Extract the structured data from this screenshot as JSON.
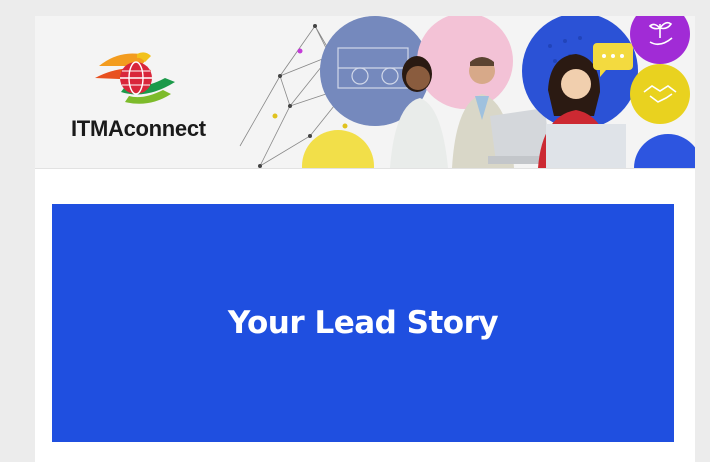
{
  "header": {
    "logo_text": "ITMAconnect",
    "logo_icon": "itma-globe-logo",
    "banner_icons": [
      "plant-hand-icon",
      "chat-bubble-icon",
      "handshake-icon"
    ]
  },
  "lead_story": {
    "title": "Your Lead Story"
  },
  "colors": {
    "lead_background": "#1f4fe0",
    "accent_purple": "#a12bd6",
    "accent_yellow": "#e9d21f",
    "accent_blue": "#2d55e0"
  }
}
